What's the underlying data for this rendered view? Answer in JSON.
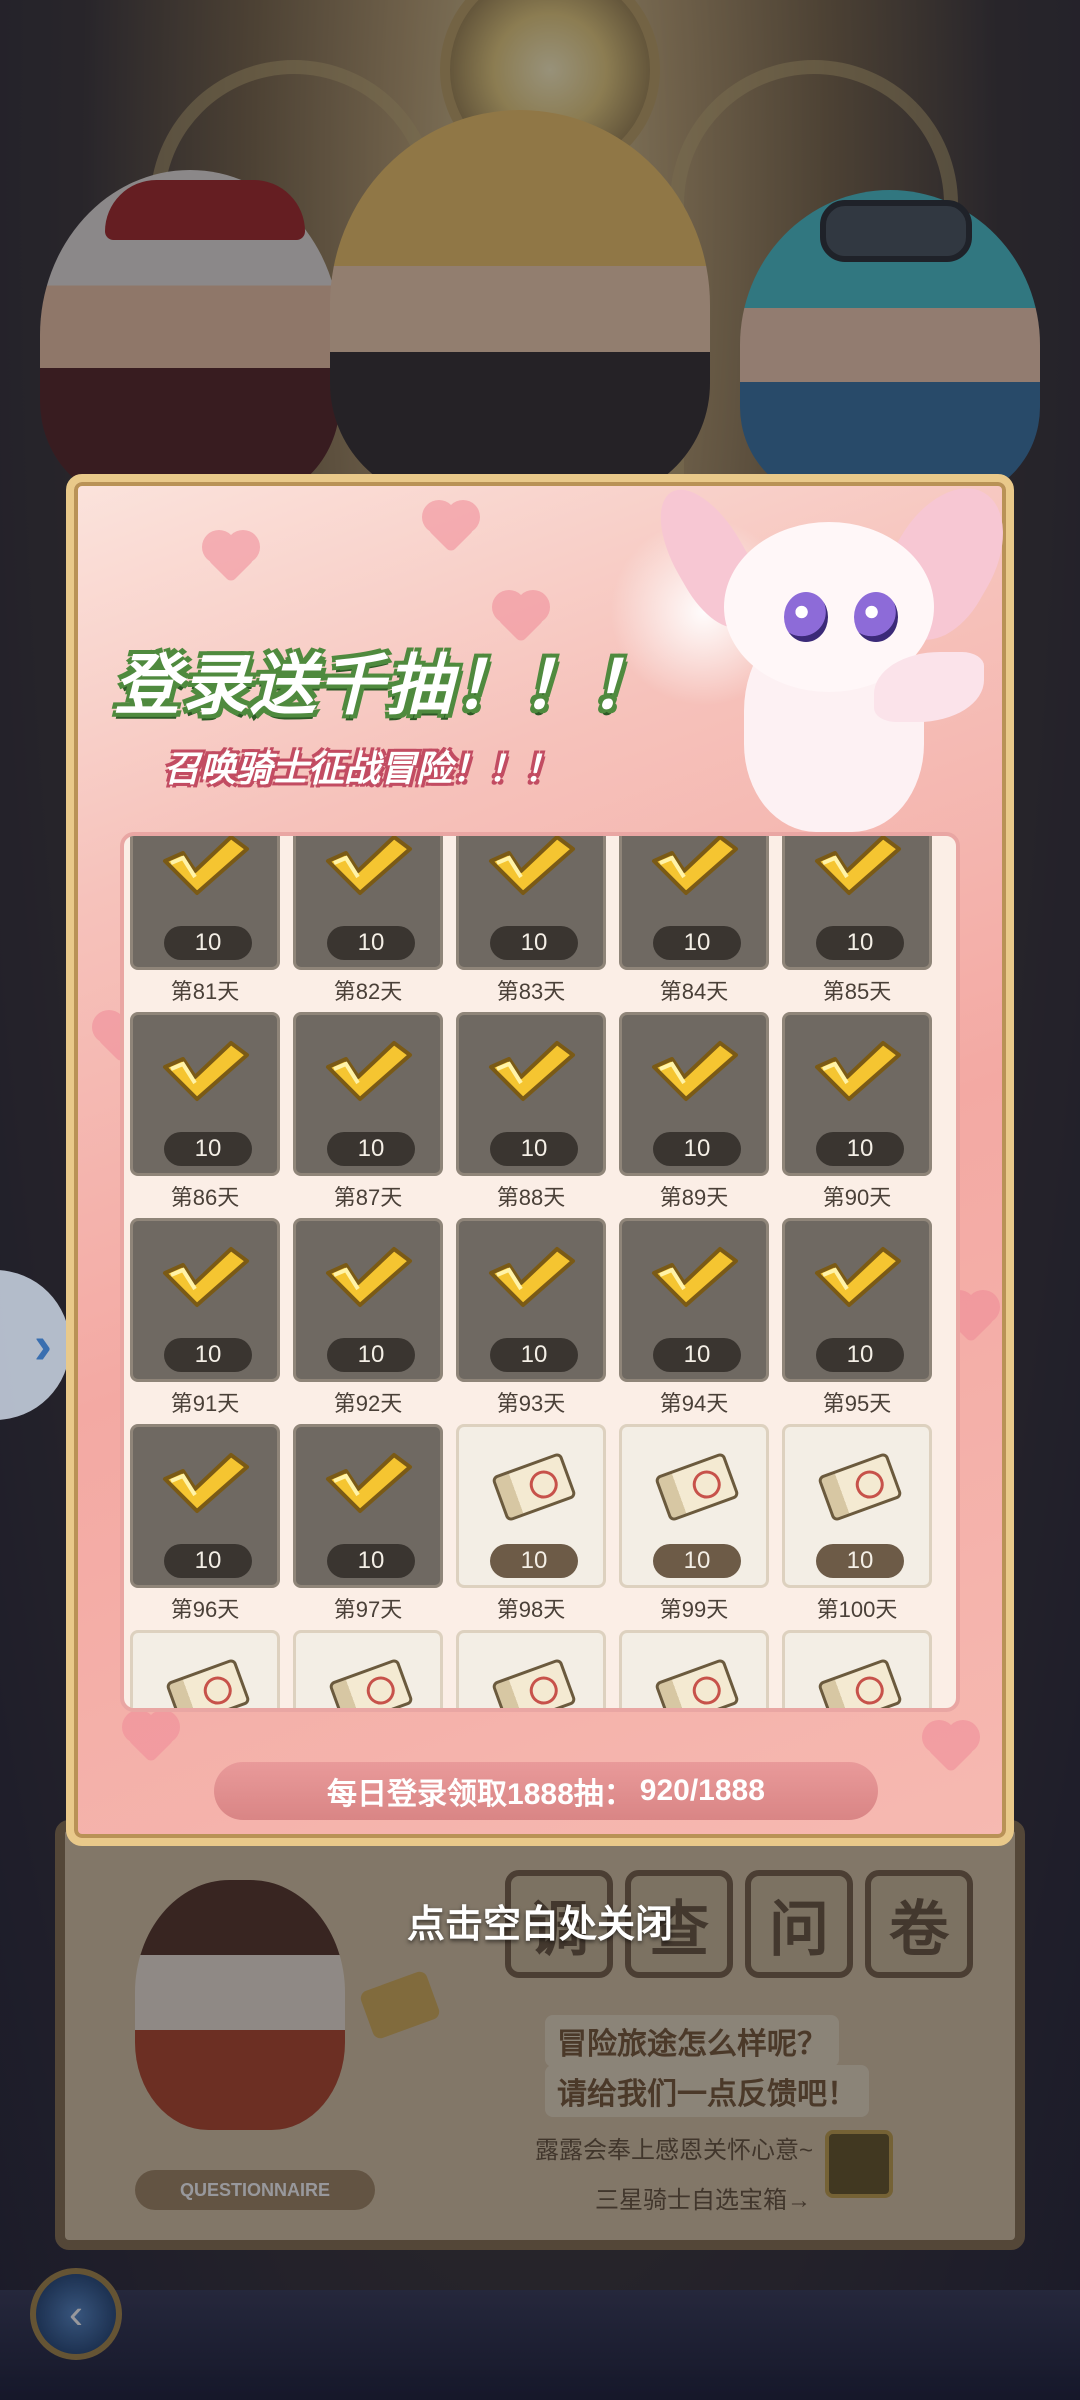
{
  "modal": {
    "title": "登录送千抽！！！",
    "subtitle": "召唤骑士征战冒险！！！",
    "progress": {
      "label": "每日登录领取1888抽：",
      "current": "920",
      "total": "1888",
      "text": "920/1888"
    },
    "days": [
      {
        "label": "第81天",
        "qty": "10",
        "state": "claimed",
        "icon": "check-icon"
      },
      {
        "label": "第82天",
        "qty": "10",
        "state": "claimed",
        "icon": "check-icon"
      },
      {
        "label": "第83天",
        "qty": "10",
        "state": "claimed",
        "icon": "check-icon"
      },
      {
        "label": "第84天",
        "qty": "10",
        "state": "claimed",
        "icon": "check-icon"
      },
      {
        "label": "第85天",
        "qty": "10",
        "state": "claimed",
        "icon": "check-icon"
      },
      {
        "label": "第86天",
        "qty": "10",
        "state": "claimed",
        "icon": "check-icon"
      },
      {
        "label": "第87天",
        "qty": "10",
        "state": "claimed",
        "icon": "check-icon"
      },
      {
        "label": "第88天",
        "qty": "10",
        "state": "claimed",
        "icon": "check-icon"
      },
      {
        "label": "第89天",
        "qty": "10",
        "state": "claimed",
        "icon": "check-icon"
      },
      {
        "label": "第90天",
        "qty": "10",
        "state": "claimed",
        "icon": "check-icon"
      },
      {
        "label": "第91天",
        "qty": "10",
        "state": "claimed",
        "icon": "check-icon"
      },
      {
        "label": "第92天",
        "qty": "10",
        "state": "claimed",
        "icon": "check-icon"
      },
      {
        "label": "第93天",
        "qty": "10",
        "state": "claimed",
        "icon": "check-icon"
      },
      {
        "label": "第94天",
        "qty": "10",
        "state": "claimed",
        "icon": "check-icon"
      },
      {
        "label": "第95天",
        "qty": "10",
        "state": "claimed",
        "icon": "check-icon"
      },
      {
        "label": "第96天",
        "qty": "10",
        "state": "claimed",
        "icon": "check-icon"
      },
      {
        "label": "第97天",
        "qty": "10",
        "state": "claimed",
        "icon": "check-icon"
      },
      {
        "label": "第98天",
        "qty": "10",
        "state": "unclaimed",
        "icon": "summon-ticket-icon"
      },
      {
        "label": "第99天",
        "qty": "10",
        "state": "unclaimed",
        "icon": "summon-ticket-icon"
      },
      {
        "label": "第100天",
        "qty": "10",
        "state": "unclaimed",
        "icon": "summon-ticket-icon"
      },
      {
        "label": "",
        "qty": "",
        "state": "unclaimed",
        "icon": "summon-ticket-icon"
      },
      {
        "label": "",
        "qty": "",
        "state": "unclaimed",
        "icon": "summon-ticket-icon"
      },
      {
        "label": "",
        "qty": "",
        "state": "unclaimed",
        "icon": "summon-ticket-icon"
      },
      {
        "label": "",
        "qty": "",
        "state": "unclaimed",
        "icon": "summon-ticket-icon"
      },
      {
        "label": "",
        "qty": "",
        "state": "unclaimed",
        "icon": "summon-ticket-icon"
      }
    ]
  },
  "close_hint": "点击空白处关闭",
  "background_panel": {
    "title_chars": [
      "调",
      "查",
      "问",
      "卷"
    ],
    "line1": "冒险旅途怎么样呢？",
    "line2": "请给我们一点反馈吧！",
    "line3": "露露会奉上感恩关怀心意~",
    "line4": "三星骑士自选宝箱→",
    "badge": "QUESTIONNAIRE"
  },
  "side_tab_icon": "chevron-right-icon",
  "back_button_icon": "arrow-left-icon",
  "colors": {
    "title_outline": "#4f8a3e",
    "subtitle_outline": "#c24c62",
    "modal_border": "#e9c98a",
    "claimed_tile": "#6f6962",
    "unclaimed_tile": "#f3eee5",
    "progress_pill": "#d98585"
  }
}
